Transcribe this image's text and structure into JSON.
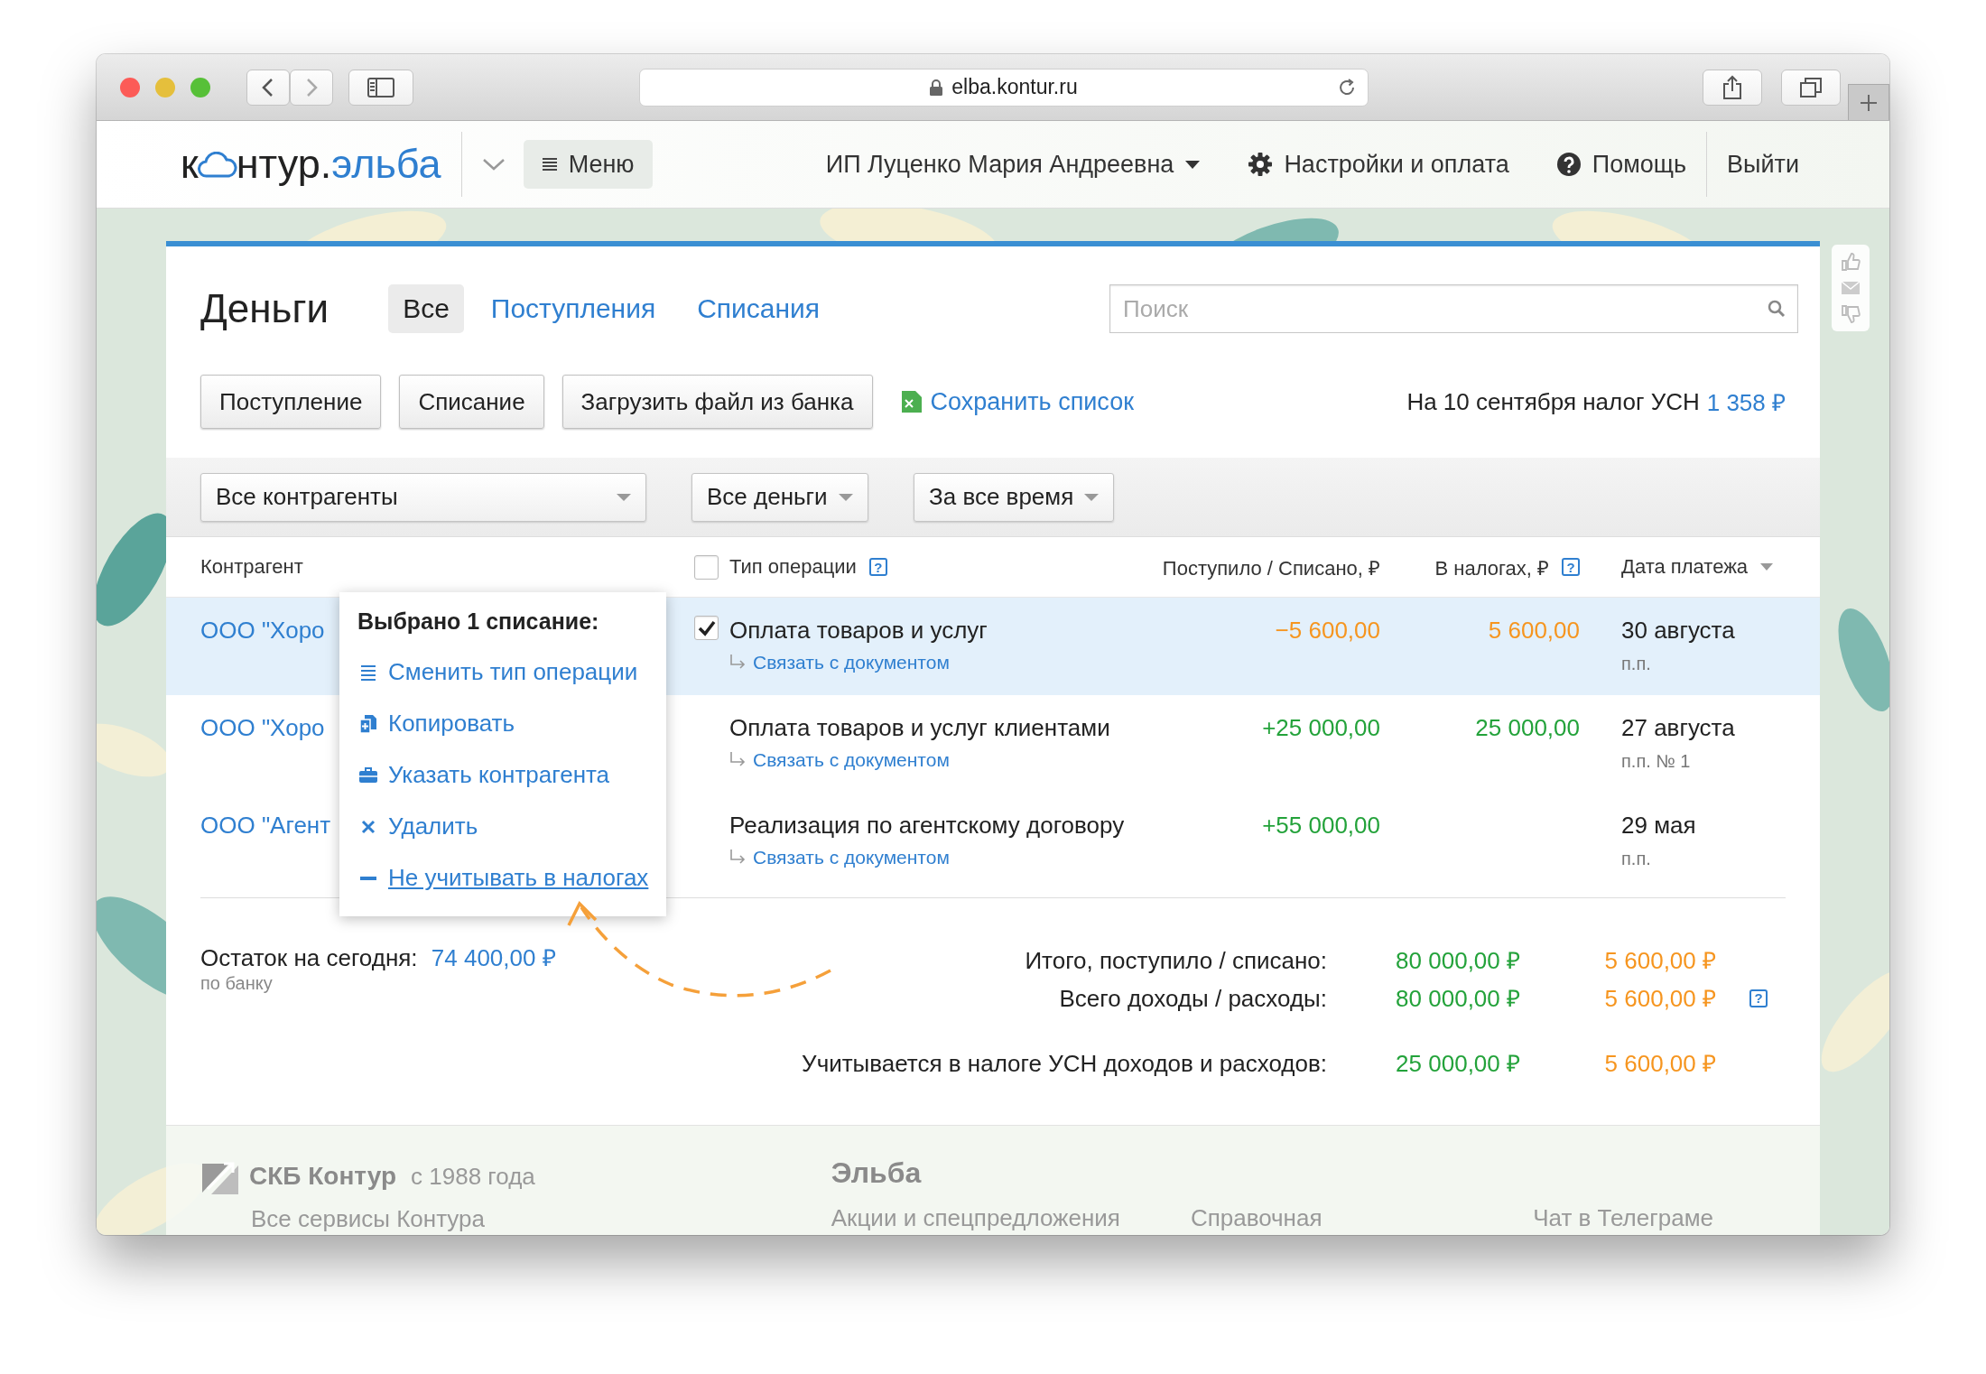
{
  "browser": {
    "url": "elba.kontur.ru"
  },
  "header": {
    "logo": {
      "before": "к",
      "after": "нтур.",
      "accent": "эльба"
    },
    "menu": "Меню",
    "user": "ИП Луценко Мария Андреевна",
    "settings": "Настройки и оплата",
    "help": "Помощь",
    "logout": "Выйти"
  },
  "page": {
    "title": "Деньги",
    "tabs": [
      {
        "label": "Все",
        "selected": true
      },
      {
        "label": "Поступления",
        "selected": false
      },
      {
        "label": "Списания",
        "selected": false
      }
    ],
    "search": {
      "placeholder": "Поиск"
    },
    "buttons": [
      "Поступление",
      "Списание",
      "Загрузить файл из банка"
    ],
    "save_list": "Сохранить список",
    "tax_note": {
      "text": "На 10 сентября налог УСН",
      "amount": "1 358 ₽"
    },
    "filters": [
      {
        "label": "Все контрагенты"
      },
      {
        "label": "Все деньги"
      },
      {
        "label": "За все время"
      }
    ]
  },
  "table": {
    "select_all": {
      "checked": false
    },
    "columns": [
      {
        "label": "Контрагент"
      },
      {
        "label": "Тип операции",
        "help": "?"
      },
      {
        "label": "Поступило / Списано, ₽"
      },
      {
        "label": "В налогах, ₽",
        "help": "?"
      },
      {
        "label": "Дата платежа"
      }
    ],
    "rows": [
      {
        "counterparty": "ООО \"Хоро",
        "selected": true,
        "type": "Оплата товаров и услуг",
        "link": "Связать с документом",
        "kind": "expense",
        "amount": "−5 600,00",
        "tax": "5 600,00",
        "date": "30 августа",
        "doc": "п.п."
      },
      {
        "counterparty": "ООО \"Хоро",
        "selected": false,
        "type": "Оплата товаров и услуг клиентами",
        "link": "Связать с документом",
        "kind": "income",
        "amount": "+25 000,00",
        "tax": "25 000,00",
        "date": "27 августа",
        "doc": "п.п. № 1"
      },
      {
        "counterparty": "ООО \"Агент",
        "selected": false,
        "type": "Реализация по агентскому договору",
        "link": "Связать с документом",
        "kind": "income",
        "amount": "+55 000,00",
        "date": "29 мая",
        "doc": "п.п."
      }
    ]
  },
  "popup": {
    "title": "Выбрано 1 списание:",
    "items": [
      {
        "kind": "list",
        "label": "Сменить тип операции",
        "hovered": false
      },
      {
        "kind": "copy",
        "label": "Копировать",
        "hovered": false
      },
      {
        "kind": "briefcase",
        "label": "Указать контрагента",
        "hovered": false
      },
      {
        "kind": "cross",
        "label": "Удалить",
        "hovered": false
      },
      {
        "kind": "minus",
        "label": "Не учитывать в налогах",
        "hovered": true
      }
    ]
  },
  "totals": {
    "balance_label": "Остаток на сегодня:",
    "balance": "74 400,00 ₽",
    "balance_note": "по банку",
    "lines": [
      {
        "label": "Итого, поступило / списано:",
        "income": "80 000,00 ₽",
        "expense": "5 600,00 ₽"
      },
      {
        "label": "Всего доходы / расходы:",
        "income": "80 000,00 ₽",
        "expense": "5 600,00 ₽",
        "help": "?"
      },
      {
        "label": "Учитывается в налоге УСН доходов и расходов:",
        "income": "25 000,00 ₽",
        "expense": "5 600,00 ₽"
      }
    ]
  },
  "footer": {
    "company": "СКБ Контур",
    "since": "с 1988 года",
    "services": "Все сервисы Контура",
    "product": "Эльба",
    "links": [
      "Акции и спецпредложения",
      "Справочная",
      "Чат в Телеграме"
    ]
  }
}
